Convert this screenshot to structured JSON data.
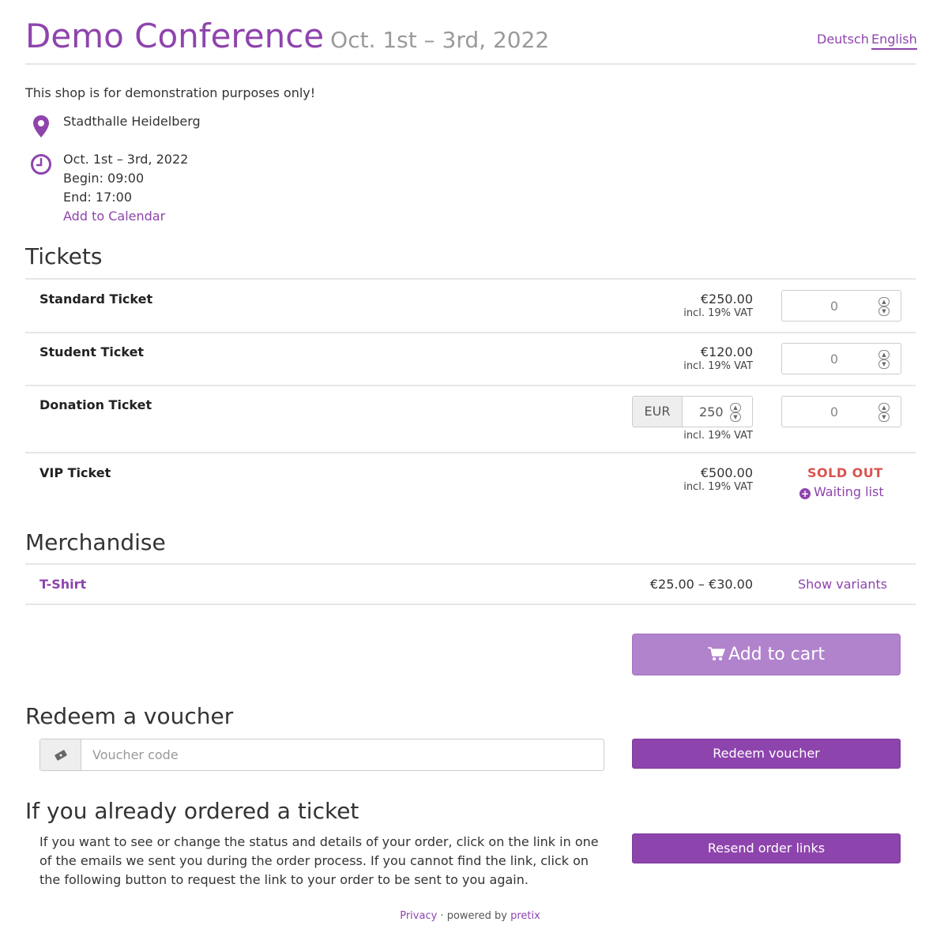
{
  "event": {
    "title": "Demo Conference",
    "date_range": "Oct. 1st – 3rd, 2022"
  },
  "languages": [
    "Deutsch",
    "English"
  ],
  "active_language": "English",
  "info": {
    "notice": "This shop is for demonstration purposes only!",
    "location": "Stadthalle Heidelberg",
    "date": "Oct. 1st – 3rd, 2022",
    "begin": "Begin: 09:00",
    "end": "End: 17:00",
    "calendar_link": "Add to Calendar"
  },
  "sections": {
    "tickets": "Tickets",
    "merchandise": "Merchandise",
    "voucher": "Redeem a voucher",
    "ordered": "If you already ordered a ticket"
  },
  "tickets": [
    {
      "name": "Standard Ticket",
      "price": "€250.00",
      "vat": "incl. 19% VAT",
      "qty": "0"
    },
    {
      "name": "Student Ticket",
      "price": "€120.00",
      "vat": "incl. 19% VAT",
      "qty": "0"
    },
    {
      "name": "Donation Ticket",
      "currency": "EUR",
      "amount": "250",
      "vat": "incl. 19% VAT",
      "qty": "0"
    },
    {
      "name": "VIP Ticket",
      "price": "€500.00",
      "vat": "incl. 19% VAT",
      "status": "SOLD OUT",
      "waiting_list": "Waiting list"
    }
  ],
  "merch": [
    {
      "name": "T-Shirt",
      "price": "€25.00 – €30.00",
      "action": "Show variants"
    }
  ],
  "buttons": {
    "add_to_cart": "Add to cart",
    "redeem": "Redeem voucher",
    "resend": "Resend order links"
  },
  "voucher": {
    "placeholder": "Voucher code"
  },
  "ordered_text": "If you want to see or change the status and details of your order, click on the link in one of the emails we sent you during the order process. If you cannot find the link, click on the following button to request the link to your order to be sent to you again.",
  "footer": {
    "privacy": "Privacy",
    "separator": " · powered by ",
    "brand": "pretix"
  },
  "colors": {
    "accent": "#8e44ad",
    "accent_light": "#b083cc",
    "sold_out": "#d9534f"
  }
}
